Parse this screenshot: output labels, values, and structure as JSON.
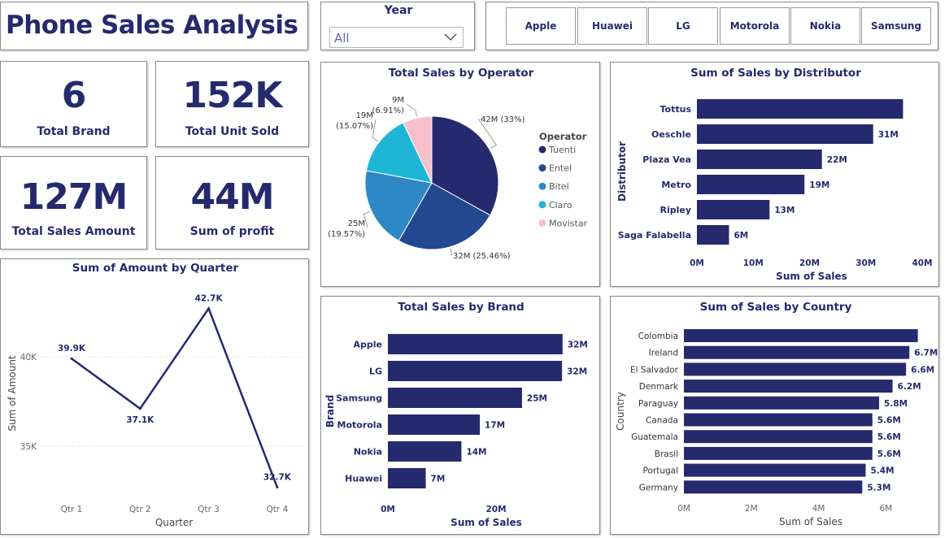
{
  "header": {
    "title": "Phone Sales Analysis"
  },
  "year_filter": {
    "label": "Year",
    "value": "All"
  },
  "brand_buttons": [
    "Apple",
    "Huawei",
    "LG",
    "Motorola",
    "Nokia",
    "Samsung"
  ],
  "kpis": [
    {
      "value": "6",
      "label": "Total Brand"
    },
    {
      "value": "152K",
      "label": "Total Unit Sold"
    },
    {
      "value": "127M",
      "label": "Total Sales Amount"
    },
    {
      "value": "44M",
      "label": "Sum of profit"
    }
  ],
  "colors": {
    "navy": "#252a6e",
    "text": "#252a6e",
    "axis_gray": "#666666"
  },
  "chart_data": [
    {
      "id": "operator",
      "type": "pie",
      "title": "Total Sales by Operator",
      "legend_title": "Operator",
      "legend_position": "right",
      "slices": [
        {
          "name": "Tuenti",
          "value": 42,
          "pct": 33,
          "label": "42M (33%)",
          "color": "#252a6e"
        },
        {
          "name": "Entel",
          "value": 32,
          "pct": 25.46,
          "label": "32M (25.46%)",
          "color": "#24488f"
        },
        {
          "name": "Bitel",
          "value": 25,
          "pct": 19.57,
          "label": "25M (19.57%)",
          "color": "#2e88c5"
        },
        {
          "name": "Claro",
          "value": 19,
          "pct": 15.07,
          "label": "19M (15.07%)",
          "color": "#1fb6d6"
        },
        {
          "name": "Movistar",
          "value": 9,
          "pct": 6.91,
          "label": "9M (6.91%)",
          "color": "#f8bfcd"
        }
      ]
    },
    {
      "id": "distributor",
      "type": "bar",
      "orientation": "horizontal",
      "title": "Sum of Sales by Distributor",
      "xlabel": "Sum of Sales",
      "ylabel": "Distributor",
      "categories": [
        "Tottus",
        "Oeschle",
        "Plaza Vea",
        "Metro",
        "Ripley",
        "Saga Falabella"
      ],
      "values": [
        36.6,
        31.3,
        22.2,
        19.1,
        12.9,
        5.7
      ],
      "value_labels": [
        "",
        "31M",
        "22M",
        "19M",
        "13M",
        "6M"
      ],
      "xticks": [
        "0M",
        "10M",
        "20M",
        "30M",
        "40M"
      ],
      "xlim": [
        0,
        40
      ],
      "grid": false
    },
    {
      "id": "quarter",
      "type": "line",
      "title": "Sum of Amount by Quarter",
      "xlabel": "Quarter",
      "ylabel": "Sum of Amount",
      "categories": [
        "Qtr 1",
        "Qtr 2",
        "Qtr 3",
        "Qtr 4"
      ],
      "values": [
        39.9,
        37.1,
        42.7,
        32.7
      ],
      "value_labels": [
        "39.9K",
        "37.1K",
        "42.7K",
        "32.7K"
      ],
      "yticks": [
        "35K",
        "40K"
      ],
      "ylim": [
        32.7,
        43
      ],
      "grid": true
    },
    {
      "id": "brand",
      "type": "bar",
      "orientation": "horizontal",
      "title": "Total Sales by Brand",
      "xlabel": "Sum of Sales",
      "ylabel": "Brand",
      "categories": [
        "Apple",
        "LG",
        "Samsung",
        "Motorola",
        "Nokia",
        "Huawei"
      ],
      "values": [
        32.3,
        32.2,
        24.8,
        17.0,
        13.6,
        7.0
      ],
      "value_labels": [
        "32M",
        "32M",
        "25M",
        "17M",
        "14M",
        "7M"
      ],
      "xticks": [
        "0M",
        "20M"
      ],
      "xlim": [
        0,
        40
      ],
      "grid": false
    },
    {
      "id": "country",
      "type": "bar",
      "orientation": "horizontal",
      "title": "Sum of Sales by Country",
      "xlabel": "Sum of Sales",
      "ylabel": "Country",
      "categories": [
        "Colombia",
        "Ireland",
        "El Salvador",
        "Denmark",
        "Paraguay",
        "Canada",
        "Guatemala",
        "Brasil",
        "Portugal",
        "Germany"
      ],
      "values": [
        6.95,
        6.7,
        6.6,
        6.2,
        5.8,
        5.6,
        5.6,
        5.6,
        5.4,
        5.3
      ],
      "value_labels": [
        "",
        "6.7M",
        "6.6M",
        "6.2M",
        "5.8M",
        "5.6M",
        "5.6M",
        "5.6M",
        "5.4M",
        "5.3M"
      ],
      "xticks": [
        "0M",
        "2M",
        "4M",
        "6M"
      ],
      "xlim": [
        0,
        7.78
      ],
      "grid": false
    }
  ]
}
